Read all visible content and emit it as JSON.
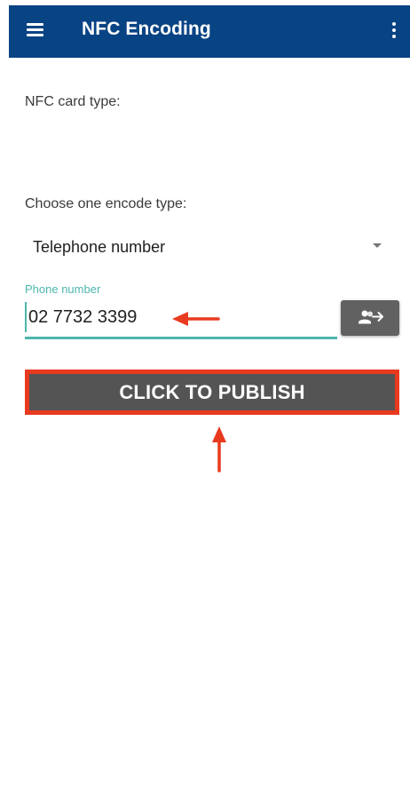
{
  "app_bar": {
    "title": "NFC Encoding",
    "background": "#084384",
    "icons": [
      "menu-icon",
      "more-vertical-icon"
    ]
  },
  "form": {
    "card_type_label": "NFC card type:",
    "encode_type_label": "Choose one encode type:",
    "encode_type_selected": "Telephone number",
    "phone_field": {
      "label": "Phone number",
      "value": "02 7732 3399",
      "accent": "#4db6ac"
    },
    "contacts_button_icon": "contacts-arrow-icon",
    "publish_button_label": "CLICK TO PUBLISH"
  },
  "annotations": {
    "color": "#e83a1f",
    "items": [
      "left-arrow-icon",
      "up-arrow-icon",
      "highlight-box"
    ]
  }
}
